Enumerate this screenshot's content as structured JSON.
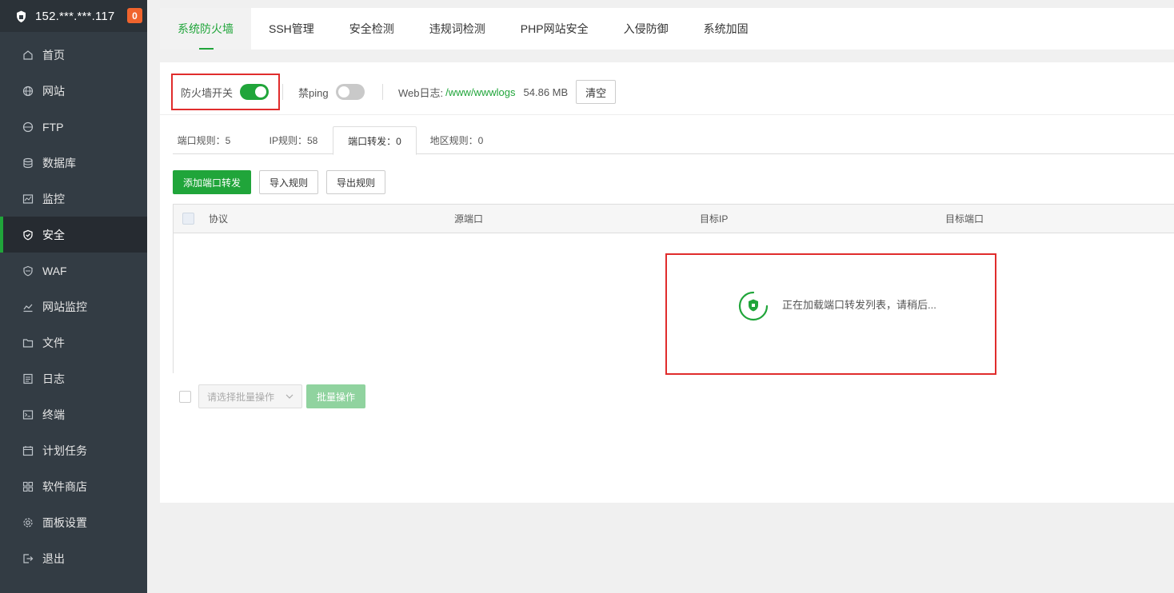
{
  "sidebar": {
    "server_ip": "152.***.***.117",
    "badge_count": "0",
    "items": [
      {
        "label": "首页",
        "icon": "home-icon"
      },
      {
        "label": "网站",
        "icon": "globe-icon"
      },
      {
        "label": "FTP",
        "icon": "ftp-icon"
      },
      {
        "label": "数据库",
        "icon": "database-icon"
      },
      {
        "label": "监控",
        "icon": "monitor-icon"
      },
      {
        "label": "安全",
        "icon": "shield-icon",
        "active": true
      },
      {
        "label": "WAF",
        "icon": "waf-icon"
      },
      {
        "label": "网站监控",
        "icon": "chart-icon"
      },
      {
        "label": "文件",
        "icon": "folder-icon"
      },
      {
        "label": "日志",
        "icon": "log-icon"
      },
      {
        "label": "终端",
        "icon": "terminal-icon"
      },
      {
        "label": "计划任务",
        "icon": "calendar-icon"
      },
      {
        "label": "软件商店",
        "icon": "apps-icon"
      },
      {
        "label": "面板设置",
        "icon": "settings-icon"
      },
      {
        "label": "退出",
        "icon": "logout-icon"
      }
    ]
  },
  "top_tabs": [
    "系统防火墙",
    "SSH管理",
    "安全检测",
    "违规词检测",
    "PHP网站安全",
    "入侵防御",
    "系统加固"
  ],
  "controls": {
    "firewall_label": "防火墙开关",
    "firewall_on": true,
    "ping_label": "禁ping",
    "ping_on": false,
    "weblog_label": "Web日志:",
    "weblog_path": "/www/wwwlogs",
    "weblog_size": "54.86 MB",
    "clear_label": "清空"
  },
  "sub_tabs": [
    "端口规则：5",
    "IP规则：58",
    "端口转发：0",
    "地区规则：0"
  ],
  "actions": {
    "add_label": "添加端口转发",
    "import_label": "导入规则",
    "export_label": "导出规则"
  },
  "table": {
    "columns": [
      "协议",
      "源端口",
      "目标IP",
      "目标端口"
    ],
    "loading_text": "正在加载端口转发列表，请稍后..."
  },
  "batch": {
    "select_placeholder": "请选择批量操作",
    "batch_label": "批量操作"
  },
  "colors": {
    "accent": "#20a53a",
    "sidebar_bg": "#333c44",
    "badge": "#f0642d",
    "highlight_border": "#e02c2c"
  }
}
